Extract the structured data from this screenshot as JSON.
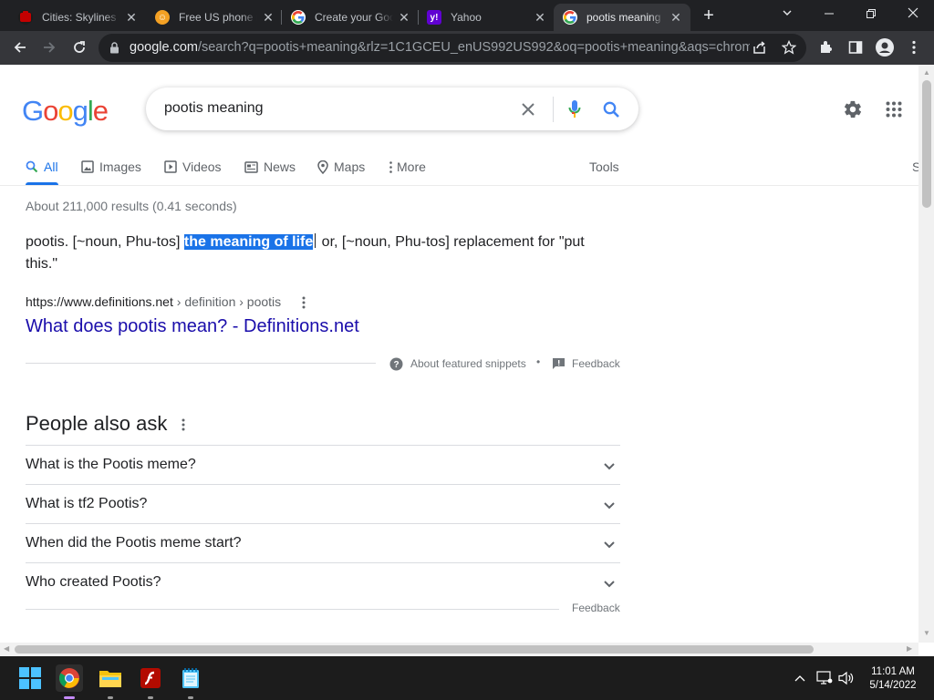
{
  "browser": {
    "tabs": [
      {
        "title": "Cities: Skylines E",
        "favicon": "steam-red-icon",
        "active": false
      },
      {
        "title": "Free US phone n",
        "favicon": "phone-orange-icon",
        "active": false
      },
      {
        "title": "Create your Goo",
        "favicon": "google-icon",
        "active": false
      },
      {
        "title": "Yahoo",
        "favicon": "yahoo-icon",
        "active": false
      },
      {
        "title": "pootis meaning",
        "favicon": "google-icon",
        "active": true
      }
    ],
    "url_host": "google.com",
    "url_path": "/search?q=pootis+meaning&rlz=1C1GCEU_enUS992US992&oq=pootis+meaning&aqs=chrom..."
  },
  "google": {
    "logo": "Google",
    "query": "pootis meaning",
    "tabs": [
      "All",
      "Images",
      "Videos",
      "News",
      "Maps",
      "More"
    ],
    "tools_label": "Tools",
    "cut_label": "S",
    "result_stats": "About 211,000 results (0.41 seconds)",
    "snippet": {
      "before": "pootis. [~noun, Phu-tos] ",
      "highlight": "the meaning of life",
      "after": " or, [~noun, Phu-tos] replacement for \"put this.\""
    },
    "result": {
      "cite_domain": "https://www.definitions.net",
      "cite_path": " › definition › pootis",
      "title": "What does pootis mean? - Definitions.net"
    },
    "about_snippets": "About featured snippets",
    "feedback": "Feedback",
    "paa": {
      "title": "People also ask",
      "questions": [
        "What is the Pootis meme?",
        "What is tf2 Pootis?",
        "When did the Pootis meme start?",
        "Who created Pootis?"
      ],
      "feedback": "Feedback"
    }
  },
  "taskbar": {
    "time": "11:01 AM",
    "date": "5/14/2022"
  },
  "colors": {
    "google_blue": "#4285f4",
    "google_red": "#ea4335",
    "google_yellow": "#fbbc05",
    "google_green": "#34a853",
    "link": "#1a0dab",
    "active_tab": "#1a73e8"
  }
}
